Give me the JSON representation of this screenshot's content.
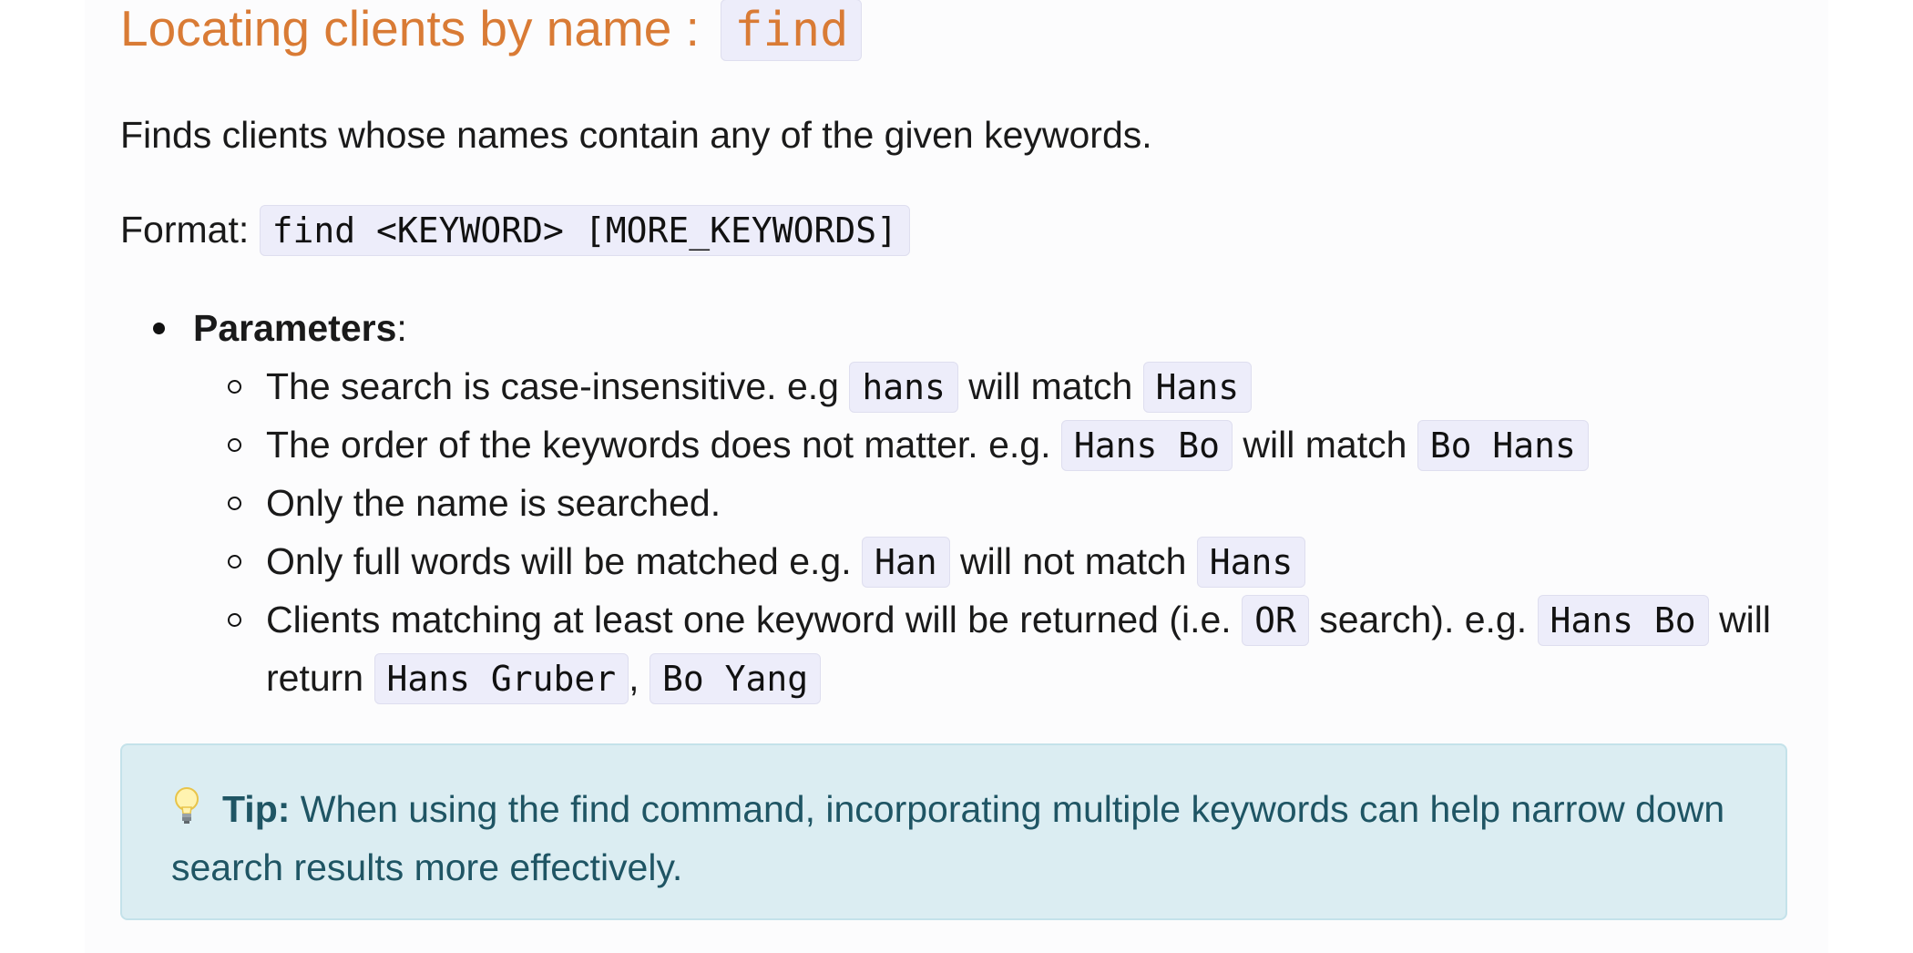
{
  "heading": {
    "text": "Locating clients by name : ",
    "command": "find"
  },
  "intro": "Finds clients whose names contain any of the given keywords.",
  "format": {
    "label": "Format: ",
    "code": "find <KEYWORD> [MORE_KEYWORDS]"
  },
  "params": {
    "title": "Parameters",
    "colon": ":",
    "items": [
      {
        "t1": "The search is case-insensitive. e.g ",
        "c1": "hans",
        "t2": " will match ",
        "c2": "Hans"
      },
      {
        "t1": "The order of the keywords does not matter. e.g. ",
        "c1": "Hans Bo",
        "t2": " will match ",
        "c2": "Bo Hans"
      },
      {
        "t1": "Only the name is searched."
      },
      {
        "t1": "Only full words will be matched e.g. ",
        "c1": "Han",
        "t2": " will not match ",
        "c2": "Hans"
      },
      {
        "t1": "Clients matching at least one keyword will be returned (i.e. ",
        "c1": "OR",
        "t2": " search). e.g. ",
        "c2": "Hans Bo",
        "t3": " will return ",
        "c3": "Hans Gruber",
        "t4": ", ",
        "c4": "Bo Yang"
      }
    ]
  },
  "tip": {
    "icon": "lightbulb-icon",
    "label": "Tip:",
    "text": " When using the find command, incorporating multiple keywords can help narrow down search results more effectively."
  },
  "colors": {
    "heading": "#d97b35",
    "code_bg": "#ededfa",
    "tip_bg": "#dbedf2",
    "tip_text": "#1f5564"
  }
}
